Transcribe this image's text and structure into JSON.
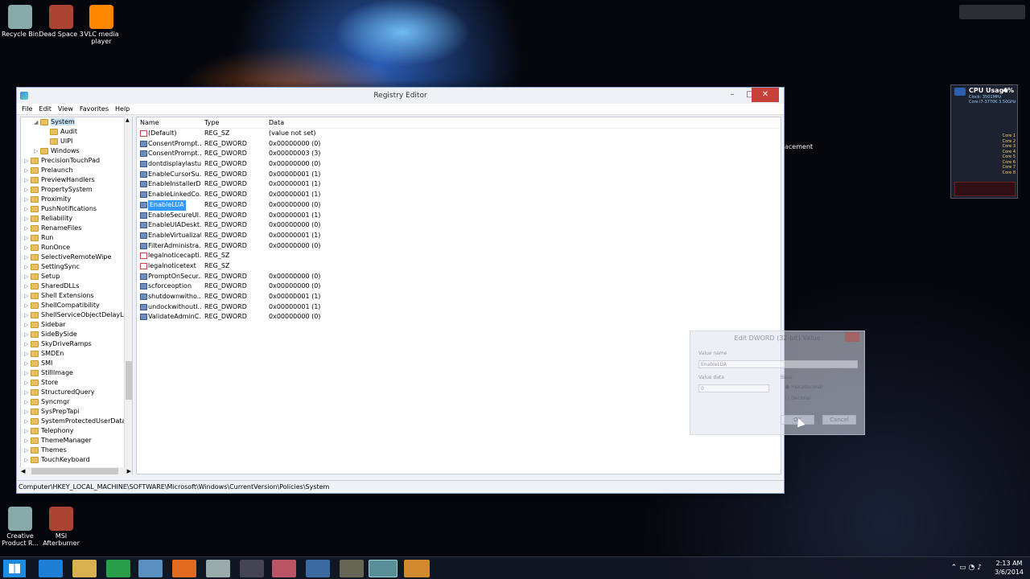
{
  "desktop": {
    "icons_top": [
      {
        "label": "Recycle Bin",
        "icon": "recycle-bin-icon"
      },
      {
        "label": "Dead Space 3",
        "icon": "dead-space-icon"
      },
      {
        "label": "VLC media player",
        "icon": "vlc-icon"
      }
    ],
    "icons_bottom": [
      {
        "label": "Creative Product R...",
        "icon": "creative-icon"
      },
      {
        "label": "MSI Afterburner",
        "icon": "afterburner-icon"
      }
    ],
    "partial_label_right": "acement"
  },
  "regedit": {
    "title": "Registry Editor",
    "menu": [
      "File",
      "Edit",
      "View",
      "Favorites",
      "Help"
    ],
    "tree": [
      {
        "label": "System",
        "level": 1,
        "expanded": true,
        "selected": true
      },
      {
        "label": "Audit",
        "level": 2
      },
      {
        "label": "UIPI",
        "level": 2
      },
      {
        "label": "Windows",
        "level": 1
      },
      {
        "label": "PrecisionTouchPad",
        "level": 0
      },
      {
        "label": "Prelaunch",
        "level": 0
      },
      {
        "label": "PreviewHandlers",
        "level": 0
      },
      {
        "label": "PropertySystem",
        "level": 0
      },
      {
        "label": "Proximity",
        "level": 0
      },
      {
        "label": "PushNotifications",
        "level": 0
      },
      {
        "label": "Reliability",
        "level": 0
      },
      {
        "label": "RenameFiles",
        "level": 0
      },
      {
        "label": "Run",
        "level": 0
      },
      {
        "label": "RunOnce",
        "level": 0
      },
      {
        "label": "SelectiveRemoteWipe",
        "level": 0
      },
      {
        "label": "SettingSync",
        "level": 0
      },
      {
        "label": "Setup",
        "level": 0
      },
      {
        "label": "SharedDLLs",
        "level": 0
      },
      {
        "label": "Shell Extensions",
        "level": 0
      },
      {
        "label": "ShellCompatibility",
        "level": 0
      },
      {
        "label": "ShellServiceObjectDelayLoad",
        "level": 0
      },
      {
        "label": "Sidebar",
        "level": 0
      },
      {
        "label": "SideBySide",
        "level": 0
      },
      {
        "label": "SkyDriveRamps",
        "level": 0
      },
      {
        "label": "SMDEn",
        "level": 0
      },
      {
        "label": "SMI",
        "level": 0
      },
      {
        "label": "StillImage",
        "level": 0
      },
      {
        "label": "Store",
        "level": 0
      },
      {
        "label": "StructuredQuery",
        "level": 0
      },
      {
        "label": "Syncmgr",
        "level": 0
      },
      {
        "label": "SysPrepTapi",
        "level": 0
      },
      {
        "label": "SystemProtectedUserData",
        "level": 0
      },
      {
        "label": "Telephony",
        "level": 0
      },
      {
        "label": "ThemeManager",
        "level": 0
      },
      {
        "label": "Themes",
        "level": 0
      },
      {
        "label": "TouchKeyboard",
        "level": 0
      }
    ],
    "columns": {
      "name": "Name",
      "type": "Type",
      "data": "Data"
    },
    "values": [
      {
        "name": "(Default)",
        "type": "REG_SZ",
        "data": "(value not set)",
        "kind": "sz"
      },
      {
        "name": "ConsentPrompt...",
        "type": "REG_DWORD",
        "data": "0x00000000 (0)",
        "kind": "dword"
      },
      {
        "name": "ConsentPrompt...",
        "type": "REG_DWORD",
        "data": "0x00000003 (3)",
        "kind": "dword"
      },
      {
        "name": "dontdisplaylastu...",
        "type": "REG_DWORD",
        "data": "0x00000000 (0)",
        "kind": "dword"
      },
      {
        "name": "EnableCursorSu...",
        "type": "REG_DWORD",
        "data": "0x00000001 (1)",
        "kind": "dword"
      },
      {
        "name": "EnableInstallerD...",
        "type": "REG_DWORD",
        "data": "0x00000001 (1)",
        "kind": "dword"
      },
      {
        "name": "EnableLinkedCo...",
        "type": "REG_DWORD",
        "data": "0x00000001 (1)",
        "kind": "dword"
      },
      {
        "name": "EnableLUA",
        "type": "REG_DWORD",
        "data": "0x00000000 (0)",
        "kind": "dword",
        "selected": true
      },
      {
        "name": "EnableSecureUI...",
        "type": "REG_DWORD",
        "data": "0x00000001 (1)",
        "kind": "dword"
      },
      {
        "name": "EnableUIADeskt...",
        "type": "REG_DWORD",
        "data": "0x00000000 (0)",
        "kind": "dword"
      },
      {
        "name": "EnableVirtualizat...",
        "type": "REG_DWORD",
        "data": "0x00000001 (1)",
        "kind": "dword"
      },
      {
        "name": "FilterAdministra...",
        "type": "REG_DWORD",
        "data": "0x00000000 (0)",
        "kind": "dword"
      },
      {
        "name": "legalnoticecapti...",
        "type": "REG_SZ",
        "data": "",
        "kind": "sz"
      },
      {
        "name": "legalnoticetext",
        "type": "REG_SZ",
        "data": "",
        "kind": "sz"
      },
      {
        "name": "PromptOnSecur...",
        "type": "REG_DWORD",
        "data": "0x00000000 (0)",
        "kind": "dword"
      },
      {
        "name": "scforceoption",
        "type": "REG_DWORD",
        "data": "0x00000000 (0)",
        "kind": "dword"
      },
      {
        "name": "shutdownwitho...",
        "type": "REG_DWORD",
        "data": "0x00000001 (1)",
        "kind": "dword"
      },
      {
        "name": "undockwithoutl...",
        "type": "REG_DWORD",
        "data": "0x00000001 (1)",
        "kind": "dword"
      },
      {
        "name": "ValidateAdminC...",
        "type": "REG_DWORD",
        "data": "0x00000000 (0)",
        "kind": "dword"
      }
    ],
    "status_path": "Computer\\HKEY_LOCAL_MACHINE\\SOFTWARE\\Microsoft\\Windows\\CurrentVersion\\Policies\\System"
  },
  "dialog": {
    "title": "Edit DWORD (32-bit) Value",
    "value_name_label": "Value name",
    "value_name": "EnableLUA",
    "value_data_label": "Value data",
    "value_data": "0",
    "base_label": "Base",
    "hex_label": "Hexadecimal",
    "dec_label": "Decimal",
    "ok_label": "OK",
    "cancel_label": "Cancel"
  },
  "gadget": {
    "title": "CPU Usage",
    "percent": "4%",
    "clock": "Clock: 3501MHz",
    "cpu": "Core i7-3770K 3.50GHz",
    "cores": [
      "Core 1",
      "Core 2",
      "Core 3",
      "Core 4",
      "Core 5",
      "Core 6",
      "Core 7",
      "Core 8"
    ]
  },
  "clock": {
    "time": "2:13 AM",
    "date": "3/6/2014"
  },
  "colors": {
    "accent": "#3399ff",
    "close": "#c7403a"
  }
}
